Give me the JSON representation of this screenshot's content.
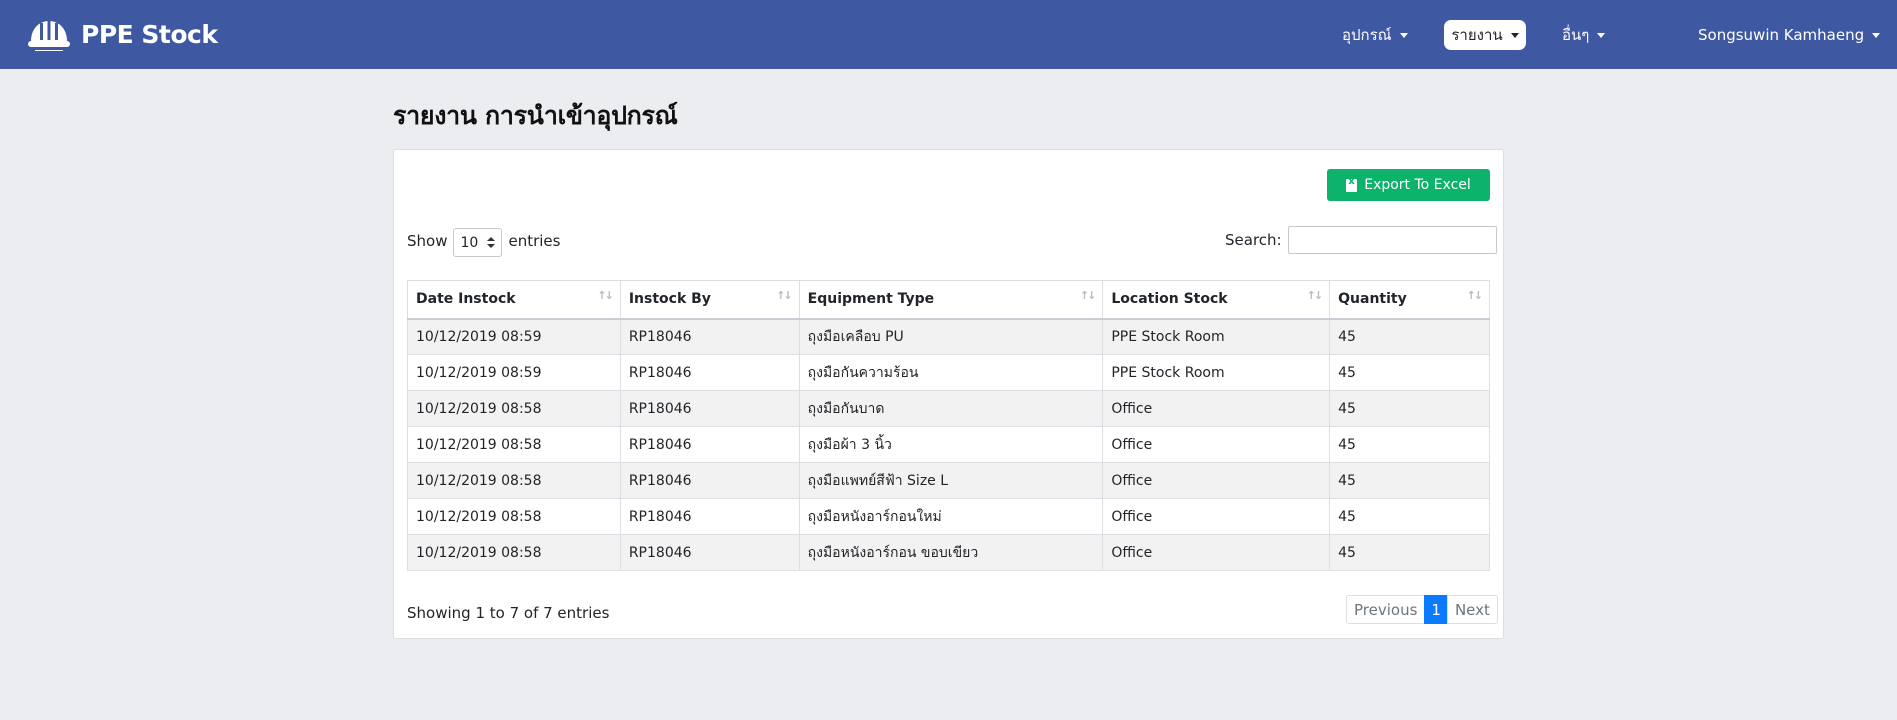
{
  "navbar": {
    "brand": "PPE Stock",
    "menu": [
      {
        "label": "อุปกรณ์"
      },
      {
        "label": "รายงาน"
      },
      {
        "label": "อื่นๆ"
      }
    ],
    "user": "Songsuwin Kamhaeng",
    "colors": {
      "bar": "#3e58a2"
    }
  },
  "page": {
    "title": "รายงาน การนำเข้าอุปกรณ์"
  },
  "toolbar": {
    "export_label": "Export To Excel",
    "export_color": "#0db36a"
  },
  "length": {
    "show": "Show",
    "value": "10",
    "entries": "entries"
  },
  "search": {
    "label": "Search:",
    "value": ""
  },
  "table": {
    "headers": [
      "Date Instock",
      "Instock By",
      "Equipment Type",
      "Location Stock",
      "Quantity"
    ],
    "rows": [
      [
        "10/12/2019 08:59",
        "RP18046",
        "ถุงมือเคลือบ PU",
        "PPE Stock Room",
        "45"
      ],
      [
        "10/12/2019 08:59",
        "RP18046",
        "ถุงมือกันความร้อน",
        "PPE Stock Room",
        "45"
      ],
      [
        "10/12/2019 08:58",
        "RP18046",
        "ถุงมือกันบาด",
        "Office",
        "45"
      ],
      [
        "10/12/2019 08:58",
        "RP18046",
        "ถุงมือผ้า 3 นิ้ว",
        "Office",
        "45"
      ],
      [
        "10/12/2019 08:58",
        "RP18046",
        "ถุงมือแพทย์สีฟ้า Size L",
        "Office",
        "45"
      ],
      [
        "10/12/2019 08:58",
        "RP18046",
        "ถุงมือหนังอาร์กอนใหม่",
        "Office",
        "45"
      ],
      [
        "10/12/2019 08:58",
        "RP18046",
        "ถุงมือหนังอาร์กอน ขอบเขียว",
        "Office",
        "45"
      ]
    ]
  },
  "footer": {
    "info": "Showing 1 to 7 of 7 entries",
    "pagination": {
      "previous": "Previous",
      "current": "1",
      "next": "Next"
    }
  }
}
